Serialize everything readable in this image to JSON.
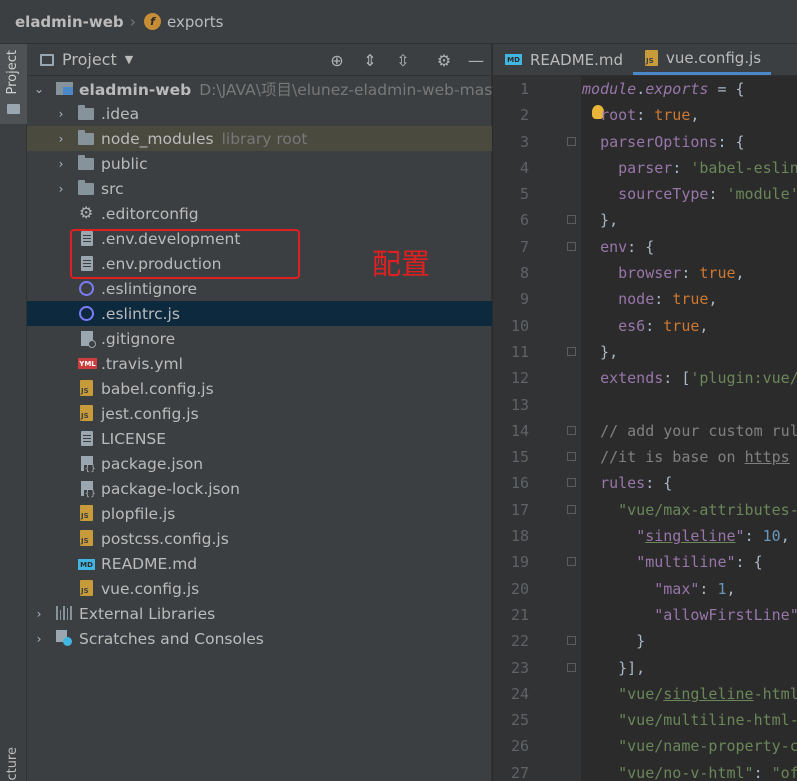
{
  "breadcrumb": {
    "project": "eladmin-web",
    "file": "exports",
    "file_badge": "f"
  },
  "left_strip": {
    "project_label": "Project",
    "structure_label": "cture"
  },
  "project_panel": {
    "title": "Project",
    "root": {
      "name": "eladmin-web",
      "path": "D:\\JAVA\\项目\\elunez-eladmin-web-master"
    },
    "items": [
      {
        "label": ".idea",
        "type": "folder"
      },
      {
        "label": "node_modules",
        "type": "folder",
        "note": "library root"
      },
      {
        "label": "public",
        "type": "folder"
      },
      {
        "label": "src",
        "type": "folder"
      },
      {
        "label": ".editorconfig",
        "type": "gear"
      },
      {
        "label": ".env.development",
        "type": "file"
      },
      {
        "label": ".env.production",
        "type": "file"
      },
      {
        "label": ".eslintignore",
        "type": "eslint"
      },
      {
        "label": ".eslintrc.js",
        "type": "eslint"
      },
      {
        "label": ".gitignore",
        "type": "git"
      },
      {
        "label": ".travis.yml",
        "type": "yml"
      },
      {
        "label": "babel.config.js",
        "type": "js"
      },
      {
        "label": "jest.config.js",
        "type": "js"
      },
      {
        "label": "LICENSE",
        "type": "file"
      },
      {
        "label": "package.json",
        "type": "json"
      },
      {
        "label": "package-lock.json",
        "type": "json"
      },
      {
        "label": "plopfile.js",
        "type": "js"
      },
      {
        "label": "postcss.config.js",
        "type": "js"
      },
      {
        "label": "README.md",
        "type": "md"
      },
      {
        "label": "vue.config.js",
        "type": "js"
      }
    ],
    "external_libraries": "External Libraries",
    "scratches": "Scratches and Consoles"
  },
  "annotation": {
    "text": "配置",
    "color": "#e02020"
  },
  "editor": {
    "tabs": [
      {
        "label": "README.md",
        "icon": "md-icon"
      },
      {
        "label": "vue.config.js",
        "icon": "js-icon"
      }
    ],
    "line_numbers": [
      "1",
      "2",
      "3",
      "4",
      "5",
      "6",
      "7",
      "8",
      "9",
      "10",
      "11",
      "12",
      "13",
      "14",
      "15",
      "16",
      "17",
      "18",
      "19",
      "20",
      "21",
      "22",
      "23",
      "24",
      "25",
      "26",
      "27"
    ]
  },
  "colors": {
    "keyword": "#cc7832",
    "string": "#6a8759",
    "number": "#6897bb",
    "property": "#9876aa",
    "comment": "#808080"
  }
}
